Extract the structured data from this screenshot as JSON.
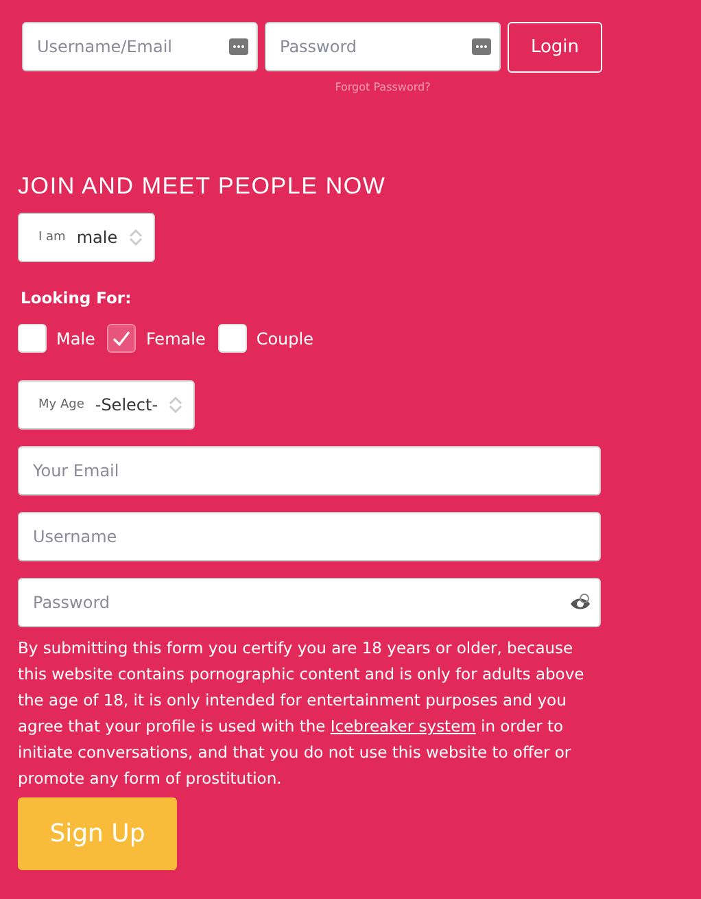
{
  "login": {
    "username": {
      "placeholder": "Username/Email"
    },
    "password": {
      "placeholder": "Password"
    },
    "button": "Login",
    "forgot": "Forgot Password?"
  },
  "signup": {
    "heading": "JOIN AND MEET PEOPLE NOW",
    "gender": {
      "label": "I am",
      "value": "male"
    },
    "looking_for": {
      "label": "Looking For:",
      "options": [
        {
          "label": "Male",
          "checked": false
        },
        {
          "label": "Female",
          "checked": true
        },
        {
          "label": "Couple",
          "checked": false
        }
      ]
    },
    "age": {
      "label": "My Age",
      "value": "-Select-"
    },
    "email": {
      "placeholder": "Your Email"
    },
    "username": {
      "placeholder": "Username"
    },
    "password": {
      "placeholder": "Password"
    },
    "terms": {
      "before": "By submitting this form you certify you are 18 years or older, because this website contains pornographic content and is only for adults above the age of 18, it is only intended for entertainment purposes and you agree that your profile is used with the",
      "link": "Icebreaker system",
      "after": "in order to initiate conversations, and that you do not use this website to offer or promote any form of prostitution."
    },
    "button": "Sign Up"
  }
}
